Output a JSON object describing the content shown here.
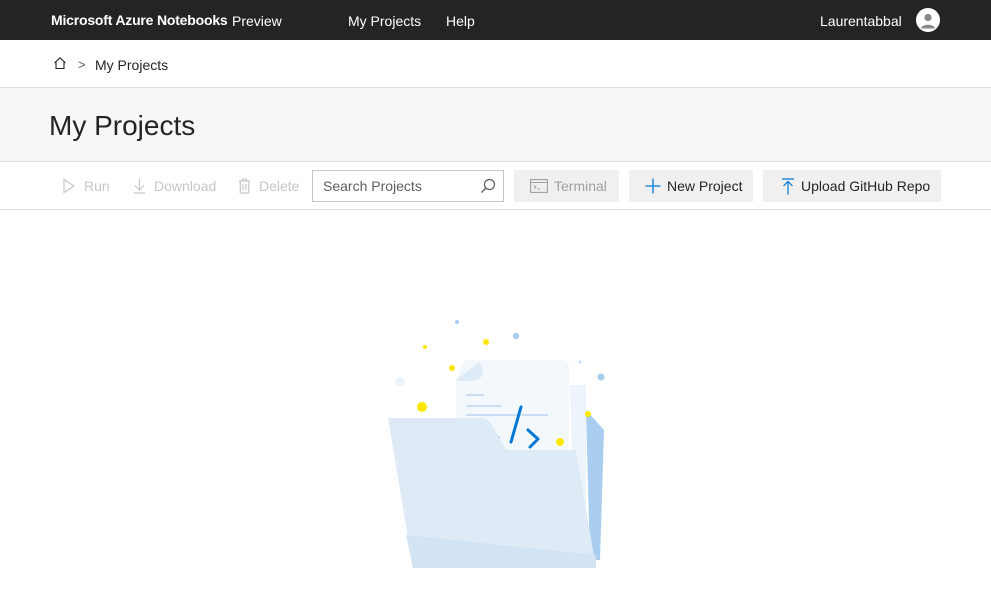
{
  "header": {
    "brand": "Microsoft Azure Notebooks",
    "preview_label": "Preview",
    "nav": [
      {
        "label": "My Projects"
      },
      {
        "label": "Help"
      }
    ],
    "username": "Laurentabbal"
  },
  "breadcrumb": {
    "separator": ">",
    "current": "My Projects"
  },
  "page": {
    "title": "My Projects"
  },
  "toolbar": {
    "run_label": "Run",
    "download_label": "Download",
    "delete_label": "Delete",
    "search_placeholder": "Search Projects",
    "search_value": "",
    "terminal_label": "Terminal",
    "new_project_label": "New Project",
    "upload_label": "Upload GitHub Repo"
  },
  "colors": {
    "topbar": "#252423",
    "accent": "#0078d4",
    "disabled_text": "#c8c6c4",
    "illustration_folder": "#deebf7",
    "illustration_dot": "#ffe600"
  },
  "icons": {
    "home": "home-icon",
    "run": "play-icon",
    "download": "download-icon",
    "delete": "trash-icon",
    "search": "search-icon",
    "terminal": "terminal-icon",
    "new_project": "plus-icon",
    "upload": "upload-icon",
    "avatar": "user-avatar-icon"
  }
}
